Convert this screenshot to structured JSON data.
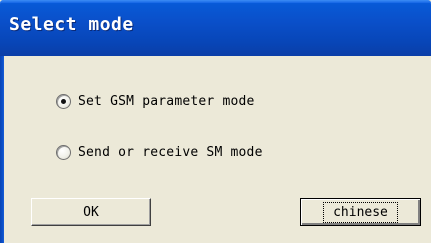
{
  "window": {
    "title": "Select mode"
  },
  "options": [
    {
      "label": "Set GSM parameter mode",
      "selected": true
    },
    {
      "label": "Send or receive SM mode",
      "selected": false
    }
  ],
  "buttons": {
    "ok_label": "OK",
    "chinese_label": "chinese"
  },
  "colors": {
    "titlebar": "#0a4fc9",
    "face": "#ece9d8"
  }
}
